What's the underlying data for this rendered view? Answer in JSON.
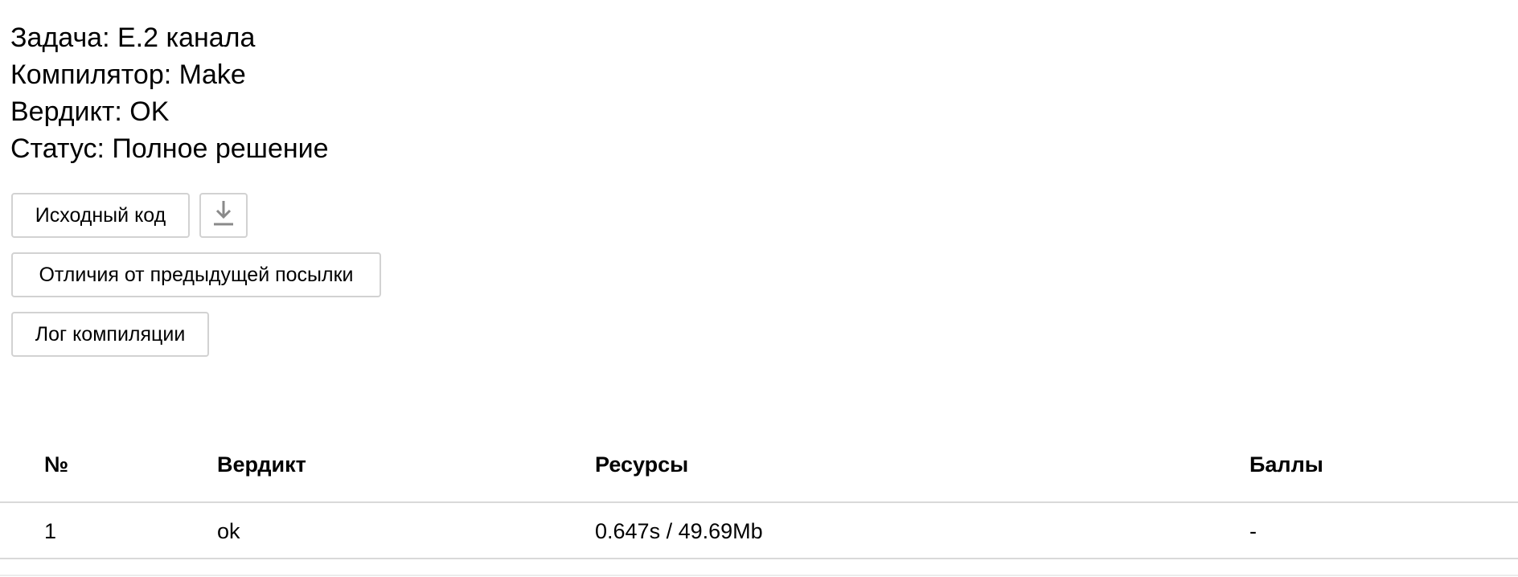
{
  "submission": {
    "task_line": "Задача: E.2 канала",
    "compiler_line": "Компилятор: Make",
    "verdict_line": "Вердикт: OK",
    "status_line": "Статус: Полное решение"
  },
  "buttons": {
    "source_code": "Исходный код",
    "download_icon": "download-icon",
    "diff_previous": "Отличия от предыдущей посылки",
    "compile_log": "Лог компиляции"
  },
  "tests_table": {
    "headers": [
      "№",
      "Вердикт",
      "Ресурсы",
      "Баллы"
    ],
    "rows": [
      [
        "1",
        "ok",
        "0.647s / 49.69Mb",
        "-"
      ]
    ]
  },
  "colors": {
    "border": "#d2d2d2",
    "divider": "#d9d9d9",
    "icon": "#8a8a8a"
  }
}
